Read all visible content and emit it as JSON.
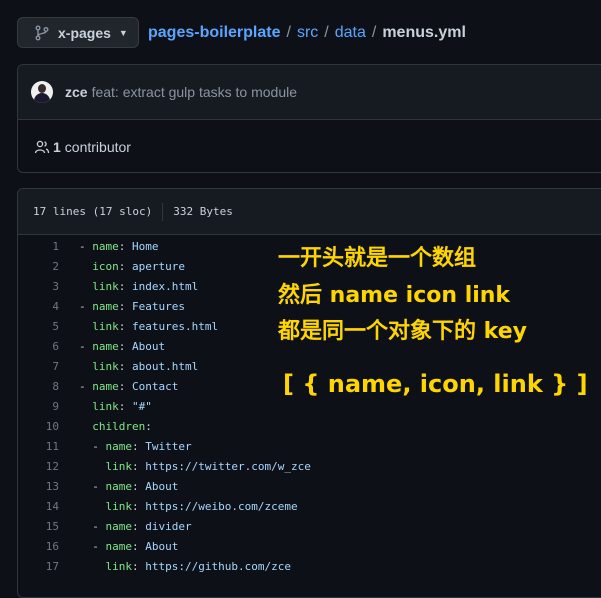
{
  "header": {
    "branch": "x-pages",
    "repo": "pages-boilerplate",
    "path": [
      "src",
      "data"
    ],
    "separator": "/",
    "file": "menus.yml"
  },
  "commit": {
    "author": "zce",
    "message": "feat: extract gulp tasks to module",
    "contributors_count": "1",
    "contributors_label": "contributor"
  },
  "file_info": {
    "lines": "17 lines (17 sloc)",
    "size": "332 Bytes"
  },
  "code_lines": [
    {
      "n": "1",
      "indent": "",
      "dash": "- ",
      "key": "name",
      "val": "Home"
    },
    {
      "n": "2",
      "indent": "  ",
      "dash": "",
      "key": "icon",
      "val": "aperture"
    },
    {
      "n": "3",
      "indent": "  ",
      "dash": "",
      "key": "link",
      "val": "index.html"
    },
    {
      "n": "4",
      "indent": "",
      "dash": "- ",
      "key": "name",
      "val": "Features"
    },
    {
      "n": "5",
      "indent": "  ",
      "dash": "",
      "key": "link",
      "val": "features.html"
    },
    {
      "n": "6",
      "indent": "",
      "dash": "- ",
      "key": "name",
      "val": "About"
    },
    {
      "n": "7",
      "indent": "  ",
      "dash": "",
      "key": "link",
      "val": "about.html"
    },
    {
      "n": "8",
      "indent": "",
      "dash": "- ",
      "key": "name",
      "val": "Contact"
    },
    {
      "n": "9",
      "indent": "  ",
      "dash": "",
      "key": "link",
      "val": "\"#\""
    },
    {
      "n": "10",
      "indent": "  ",
      "dash": "",
      "key": "children",
      "val": ""
    },
    {
      "n": "11",
      "indent": "  ",
      "dash": "- ",
      "key": "name",
      "val": "Twitter"
    },
    {
      "n": "12",
      "indent": "    ",
      "dash": "",
      "key": "link",
      "val": "https://twitter.com/w_zce"
    },
    {
      "n": "13",
      "indent": "  ",
      "dash": "- ",
      "key": "name",
      "val": "About"
    },
    {
      "n": "14",
      "indent": "    ",
      "dash": "",
      "key": "link",
      "val": "https://weibo.com/zceme"
    },
    {
      "n": "15",
      "indent": "  ",
      "dash": "- ",
      "key": "name",
      "val": "divider"
    },
    {
      "n": "16",
      "indent": "  ",
      "dash": "- ",
      "key": "name",
      "val": "About"
    },
    {
      "n": "17",
      "indent": "    ",
      "dash": "",
      "key": "link",
      "val": "https://github.com/zce"
    }
  ],
  "annotation": {
    "line1": "一开头就是一个数组",
    "line2": "然后 name icon link",
    "line3": "都是同一个对象下的 key",
    "line4": "[ { name, icon, link } ]"
  }
}
